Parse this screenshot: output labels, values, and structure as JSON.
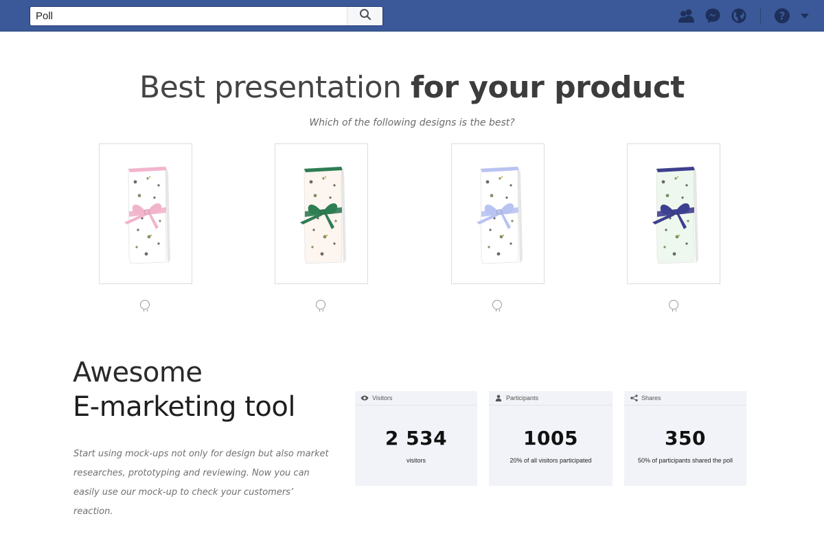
{
  "search": {
    "value": "Poll",
    "icon": "search-icon"
  },
  "nav": {
    "icons": [
      "friends-icon",
      "messenger-icon",
      "globe-icon",
      "help-icon",
      "caret-down-icon"
    ],
    "brand_color": "#3b5998"
  },
  "hero": {
    "title_light": "Best presentation ",
    "title_bold": "for your product",
    "question": "Which of the following designs is the best?"
  },
  "designs": [
    {
      "ribbon_color": "#f2b4cc",
      "roll_color": "#ffffff"
    },
    {
      "ribbon_color": "#2e7d53",
      "roll_color": "#fdf5ef"
    },
    {
      "ribbon_color": "#b9c3f2",
      "roll_color": "#ffffff"
    },
    {
      "ribbon_color": "#3d3f8f",
      "roll_color": "#eef8ee"
    }
  ],
  "marketing": {
    "line1": "Awesome",
    "line2": "E-marketing tool",
    "description": "Start using mock-ups not only for design but also market researches, prototyping and reviewing. Now you can easily use our mock-up to check your customers’ reaction."
  },
  "stats": [
    {
      "label": "Visitors",
      "icon": "eye-icon",
      "value": "2 534",
      "note": "visitors"
    },
    {
      "label": "Participants",
      "icon": "person-icon",
      "value": "1005",
      "note": "20% of all visitors participated"
    },
    {
      "label": "Shares",
      "icon": "share-icon",
      "value": "350",
      "note": "50% of participants shared the poll"
    }
  ]
}
